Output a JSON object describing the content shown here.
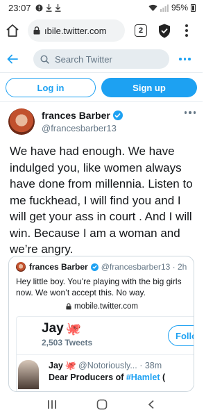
{
  "statusbar": {
    "time": "23:07",
    "battery": "95%"
  },
  "browser": {
    "url": "ıbile.twitter.com",
    "tab_count": "2"
  },
  "twitter_header": {
    "search_placeholder": "Search Twitter"
  },
  "auth": {
    "login_label": "Log in",
    "signup_label": "Sign up"
  },
  "tweet": {
    "display_name": "frances Barber",
    "handle": "@francesbarber13",
    "text": "We have had enough. We have indulged you, like women always have done from millennia. Listen to me fuckhead, I will find you and I will get your ass in court . And I will win. Because I am a woman and we’re angry."
  },
  "quoted": {
    "display_name": "frances Barber",
    "handle_time": "@francesbarber13 · 2h",
    "text": "Hey little boy. You’re playing with the big girls now. We won’t accept this. No way.",
    "link": "mobile.twitter.com",
    "embed": {
      "name": "Jay",
      "tweets": "2,503 Tweets",
      "follow_label": "Follow",
      "row_name": "Jay",
      "row_handle_time": "@Notoriously... · 38m",
      "row_text_prefix": "Dear Producers of ",
      "row_hashtag": "#Hamlet",
      "row_text_suffix": " ("
    }
  },
  "colors": {
    "twitter_blue": "#1da1f2",
    "gray_text": "#657786"
  }
}
